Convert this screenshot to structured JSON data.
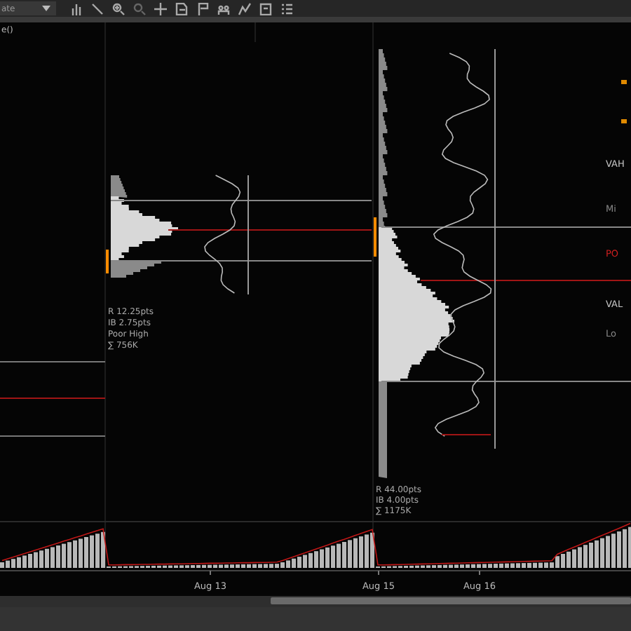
{
  "toolbar": {
    "dropdown": {
      "value": "ate"
    }
  },
  "chart": {
    "caption": "e()",
    "profiles": [
      {
        "stats": [
          "R 12.25pts",
          "IB 2.75pts",
          "Poor High",
          "∑ 756K"
        ]
      },
      {
        "stats": [
          "R 44.00pts",
          "IB 4.00pts",
          "∑ 1175K"
        ]
      }
    ],
    "level_labels": [
      {
        "text": "VAH",
        "kind": "plain"
      },
      {
        "text": "Mi",
        "kind": "dim"
      },
      {
        "text": "PO",
        "kind": "poc"
      },
      {
        "text": "VAL",
        "kind": "plain"
      },
      {
        "text": "Lo",
        "kind": "dim"
      }
    ]
  },
  "x_axis": {
    "labels": [
      "Aug 13",
      "Aug 15",
      "Aug 16"
    ]
  }
}
